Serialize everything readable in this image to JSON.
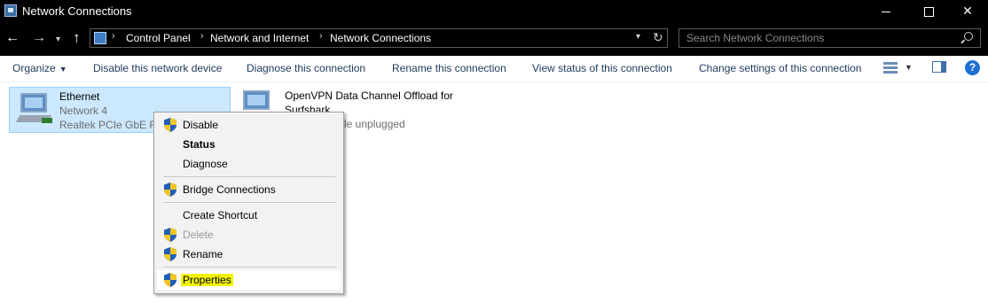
{
  "window": {
    "title": "Network Connections",
    "controls": [
      "minimize",
      "maximize",
      "close"
    ]
  },
  "address_bar": {
    "breadcrumbs": [
      "Control Panel",
      "Network and Internet",
      "Network Connections"
    ],
    "search_placeholder": "Search Network Connections"
  },
  "commands": {
    "organize": "Organize",
    "disable": "Disable this network device",
    "diagnose": "Diagnose this connection",
    "rename": "Rename this connection",
    "view_status": "View status of this connection",
    "change_settings": "Change settings of this connection"
  },
  "connections": [
    {
      "name": "Ethernet",
      "status": "Network 4",
      "device": "Realtek PCIe GbE Fa",
      "selected": true
    },
    {
      "name_line1": "OpenVPN Data Channel Offload for",
      "name_line2": "Surfshark",
      "status": "le unplugged"
    }
  ],
  "context_menu": {
    "items": [
      {
        "label": "Disable",
        "shield": true
      },
      {
        "label": "Status",
        "bold": true
      },
      {
        "label": "Diagnose"
      },
      {
        "label": "Bridge Connections",
        "shield": true
      },
      {
        "label": "Create Shortcut"
      },
      {
        "label": "Delete",
        "shield": true,
        "disabled": true
      },
      {
        "label": "Rename",
        "shield": true
      },
      {
        "label": "Properties",
        "shield": true,
        "highlighted": true
      }
    ]
  },
  "colors": {
    "title_bg": "#000000",
    "selection_bg": "#cce8ff",
    "selection_border": "#99d1ff",
    "command_text": "#1e395b",
    "highlight_marker": "#f3f300"
  }
}
